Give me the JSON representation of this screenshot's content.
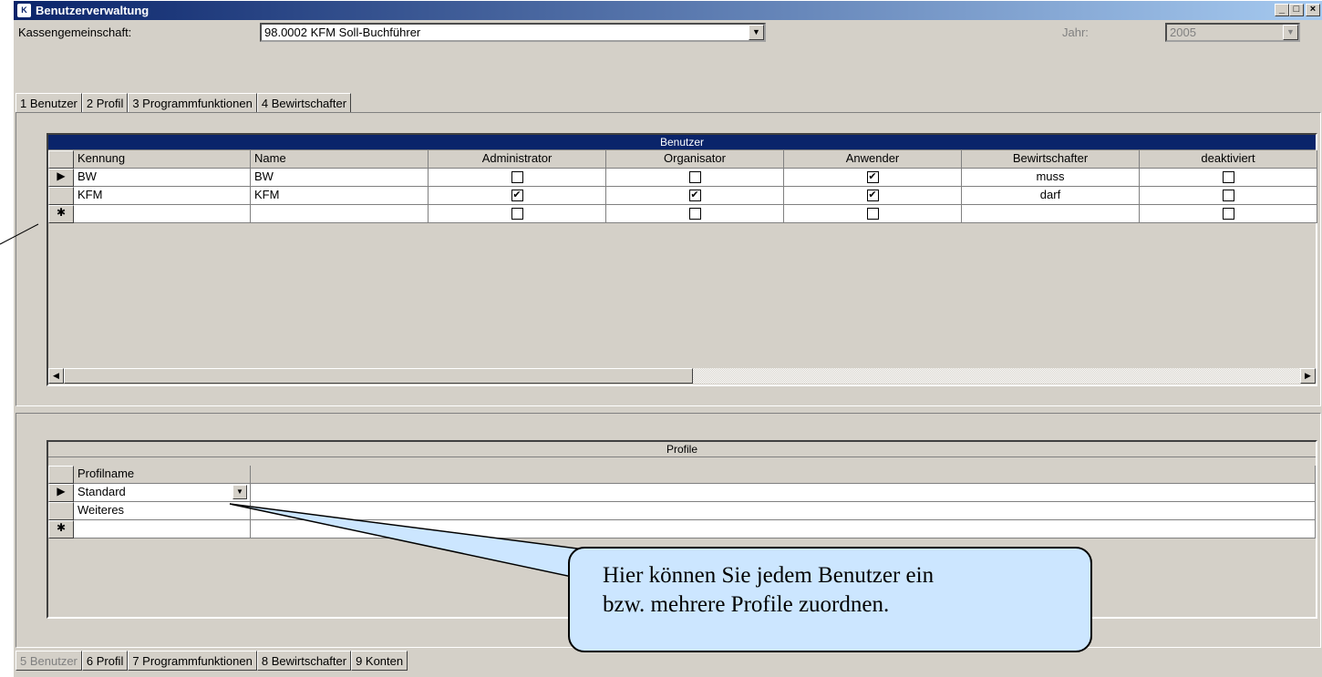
{
  "window": {
    "title": "Benutzerverwaltung",
    "app_icon": "K",
    "controls": {
      "minimize": "_",
      "maximize": "□",
      "close": "×"
    }
  },
  "header": {
    "kassen_label": "Kassengemeinschaft:",
    "kassen_value": "98.0002  KFM Soll-Buchführer",
    "jahr_label": "Jahr:",
    "jahr_value": "2005"
  },
  "top_tabs": [
    "1 Benutzer",
    "2 Profil",
    "3 Programmfunktionen",
    "4 Bewirtschafter"
  ],
  "benutzer_grid": {
    "caption": "Benutzer",
    "columns": [
      "Kennung",
      "Name",
      "Administrator",
      "Organisator",
      "Anwender",
      "Bewirtschafter",
      "deaktiviert"
    ],
    "rows": [
      {
        "kennung": "BW",
        "name": "BW",
        "administrator": false,
        "organisator": false,
        "anwender": true,
        "bewirtschafter": "muss",
        "deaktiviert": false
      },
      {
        "kennung": "KFM",
        "name": "KFM",
        "administrator": true,
        "organisator": true,
        "anwender": true,
        "bewirtschafter": "darf",
        "deaktiviert": false
      }
    ],
    "new_row_marker": "✱",
    "current_row_marker": "▶"
  },
  "profile_grid": {
    "caption": "Profile",
    "columns": [
      "Profilname"
    ],
    "rows": [
      "Standard",
      "Weiteres"
    ]
  },
  "bottom_tabs": [
    "5 Benutzer",
    "6 Profil",
    "7 Programmfunktionen",
    "8 Bewirtschafter",
    "9 Konten"
  ],
  "callout": {
    "text_line1": "Hier können Sie jedem Benutzer ein",
    "text_line2": "bzw. mehrere Profile zuordnen."
  },
  "colors": {
    "title_start": "#0a246a",
    "title_end": "#a6caf0",
    "callout_fill": "#cce6ff",
    "face": "#d4d0c8"
  }
}
